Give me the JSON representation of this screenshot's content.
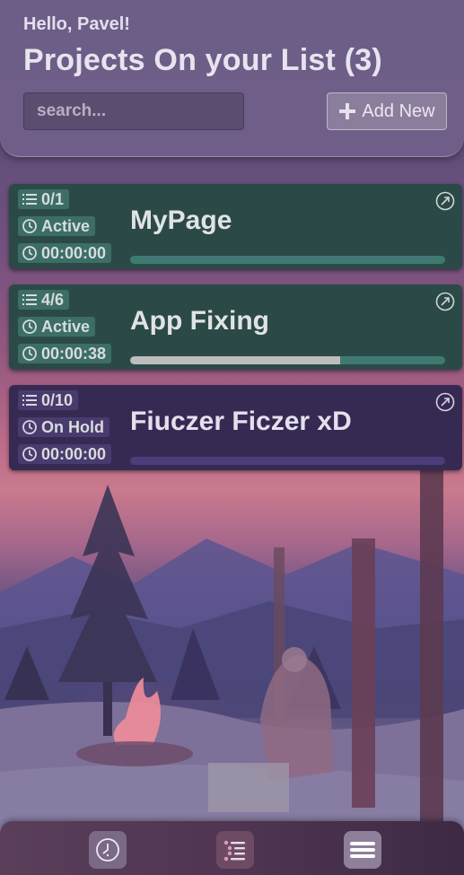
{
  "header": {
    "greeting": "Hello, Pavel!",
    "title": "Projects On your List (3)",
    "search_placeholder": "search...",
    "add_button_label": "Add New"
  },
  "projects": [
    {
      "name": "MyPage",
      "tasks": "0/1",
      "status": "Active",
      "time": "00:00:00",
      "progress": 0,
      "theme": "green"
    },
    {
      "name": "App Fixing",
      "tasks": "4/6",
      "status": "Active",
      "time": "00:00:38",
      "progress": 0.667,
      "theme": "green"
    },
    {
      "name": "Fiuczer Ficzer xD",
      "tasks": "0/10",
      "status": "On Hold",
      "time": "00:00:00",
      "progress": 0,
      "theme": "purple"
    }
  ],
  "nav": {
    "items": [
      {
        "icon": "clock-icon"
      },
      {
        "icon": "list-icon",
        "active": true
      },
      {
        "icon": "menu-icon"
      }
    ]
  },
  "colors": {
    "header_bg": "#70608a",
    "card_active": "#2b4a47",
    "card_on_hold": "#372a52",
    "progress_fill": "#bdbdbd"
  }
}
